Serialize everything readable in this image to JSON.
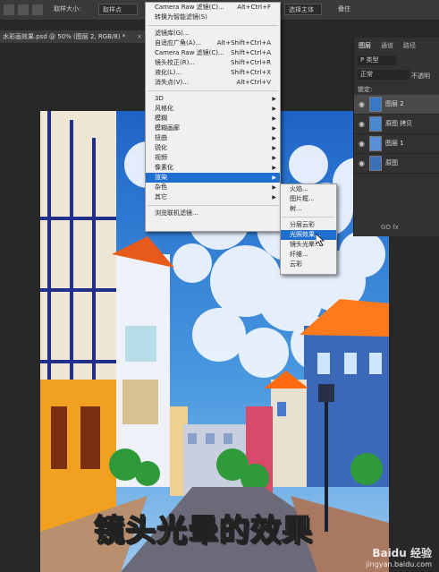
{
  "options_bar": {
    "sample_size_label": "取样大小:",
    "sample_size_value": "取样点",
    "right_button_label": "选择主体",
    "right_text": "叠住"
  },
  "document_tab": {
    "title": "水彩画效果.psd @ 50% (图层 2, RGB/8) *",
    "close": "×"
  },
  "filter_menu": {
    "items_top": [
      {
        "label": "Camera Raw 滤镜(C)...",
        "shortcut": "Alt+Ctrl+F"
      },
      {
        "label": "转换为智能滤镜(S)",
        "shortcut": ""
      }
    ],
    "items_mid": [
      {
        "label": "滤镜库(G)...",
        "shortcut": ""
      },
      {
        "label": "自适应广角(A)...",
        "shortcut": "Alt+Shift+Ctrl+A"
      },
      {
        "label": "Camera Raw 滤镜(C)...",
        "shortcut": "Shift+Ctrl+A"
      },
      {
        "label": "镜头校正(R)...",
        "shortcut": "Shift+Ctrl+R"
      },
      {
        "label": "液化(L)...",
        "shortcut": "Shift+Ctrl+X"
      },
      {
        "label": "消失点(V)...",
        "shortcut": "Alt+Ctrl+V"
      }
    ],
    "items_sub": [
      {
        "label": "3D",
        "highlighted": false
      },
      {
        "label": "风格化",
        "highlighted": false
      },
      {
        "label": "模糊",
        "highlighted": false
      },
      {
        "label": "模糊画廊",
        "highlighted": false
      },
      {
        "label": "扭曲",
        "highlighted": false
      },
      {
        "label": "锐化",
        "highlighted": false
      },
      {
        "label": "视频",
        "highlighted": false
      },
      {
        "label": "像素化",
        "highlighted": false
      },
      {
        "label": "渲染",
        "highlighted": true
      },
      {
        "label": "杂色",
        "highlighted": false
      },
      {
        "label": "其它",
        "highlighted": false
      }
    ],
    "items_bottom": [
      {
        "label": "浏览联机滤镜...",
        "shortcut": ""
      }
    ]
  },
  "render_submenu": {
    "group1": [
      {
        "label": "火焰...",
        "highlighted": false
      },
      {
        "label": "图片框...",
        "highlighted": false
      },
      {
        "label": "树...",
        "highlighted": false
      }
    ],
    "group2": [
      {
        "label": "分层云彩",
        "highlighted": false
      },
      {
        "label": "光照效果...",
        "highlighted": true
      },
      {
        "label": "镜头光晕...",
        "highlighted": false
      },
      {
        "label": "纤维...",
        "highlighted": false
      },
      {
        "label": "云彩",
        "highlighted": false
      }
    ]
  },
  "layers_panel": {
    "tabs": [
      "图层",
      "通道",
      "路径"
    ],
    "kind_label": "P 类型",
    "blend_mode": "正常",
    "opacity_label": "不透明",
    "lock_label": "锁定:",
    "layers": [
      {
        "name": "图层 2",
        "selected": true
      },
      {
        "name": "原图 拷贝",
        "selected": false
      },
      {
        "name": "图层 1",
        "selected": false
      },
      {
        "name": "原图",
        "selected": false
      }
    ],
    "footer_icons": "GO fx"
  },
  "caption": {
    "part1": "镜头光晕",
    "part2": "的效果"
  },
  "watermark": {
    "name": "Baidu 经验",
    "url": "jingyan.baidu.com"
  },
  "colors": {
    "menu_highlight": "#1f6fd0",
    "caption_yellow": "#ffe600",
    "panel_bg": "#323232"
  }
}
